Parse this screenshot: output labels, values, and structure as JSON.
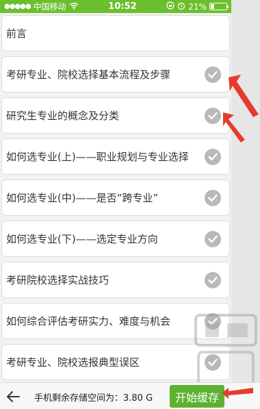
{
  "status_bar": {
    "carrier": "中国移动",
    "time": "10:52",
    "battery": "21%"
  },
  "list": {
    "items": [
      {
        "label": "前言",
        "checked": false
      },
      {
        "label": "考研专业、院校选择基本流程及步骤",
        "checked": true
      },
      {
        "label": "研究生专业的概念及分类",
        "checked": true
      },
      {
        "label": "如何选专业(上)——职业规划与专业选择",
        "checked": true
      },
      {
        "label": "如何选专业(中)——是否“跨专业”",
        "checked": true
      },
      {
        "label": "如何选专业(下)——选定专业方向",
        "checked": true
      },
      {
        "label": "考研院校选择实战技巧",
        "checked": true
      },
      {
        "label": "如何综合评估考研实力、难度与机会",
        "checked": true
      },
      {
        "label": "考研专业、院校选报典型误区",
        "checked": true
      }
    ]
  },
  "bottom_bar": {
    "storage_text": "手机剩余存储空间为：3.80 G",
    "start_button": "开始缓存"
  },
  "watermark": {
    "text": "下载吧"
  },
  "colors": {
    "status_bar": "#6cbf2c",
    "button": "#5cb230",
    "arrow": "#e63b2e",
    "check": "#b9b9b9"
  }
}
